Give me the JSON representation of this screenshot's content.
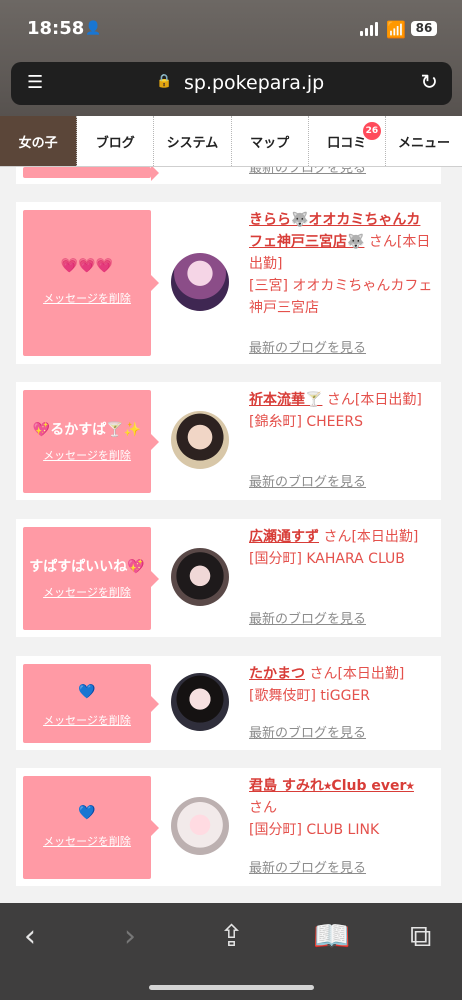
{
  "status": {
    "time": "18:58",
    "battery": "86"
  },
  "browser": {
    "url": "sp.pokepara.jp"
  },
  "tabs": [
    {
      "label": "女の子",
      "active": true
    },
    {
      "label": "ブログ"
    },
    {
      "label": "システム"
    },
    {
      "label": "マップ"
    },
    {
      "label": "口コミ",
      "badge": "26"
    },
    {
      "label": "メニュー"
    }
  ],
  "partial_blog_link": "最新のブログを見る",
  "cards": [
    {
      "message": "💗💗💗",
      "delete": "メッセージを削除",
      "name": "きらら🐺オオカミちゃんカフェ神戸三宮店🐺",
      "suffix": "さん[本日出勤]",
      "shop": "[三宮] オオカミちゃんカフェ神戸三宮店",
      "blog": "最新のブログを見る"
    },
    {
      "message": "💖るかすぱ🍸✨",
      "delete": "メッセージを削除",
      "name": "祈本流華🍸",
      "suffix": "さん[本日出勤]",
      "shop": "[錦糸町] CHEERS",
      "blog": "最新のブログを見る"
    },
    {
      "message": "すぱすぱいいね💖",
      "delete": "メッセージを削除",
      "name": "広瀬通すず",
      "suffix": "さん[本日出勤]",
      "shop": "[国分町] KAHARA CLUB",
      "blog": "最新のブログを見る"
    },
    {
      "message": "💙",
      "delete": "メッセージを削除",
      "name": "たかまつ",
      "suffix": "さん[本日出勤]",
      "shop": "[歌舞伎町] tiGGER",
      "blog": "最新のブログを見る"
    },
    {
      "message": "💙",
      "delete": "メッセージを削除",
      "name": "君島 すみれ⭑Club ever⭑",
      "suffix": "さん",
      "shop": "[国分町] CLUB LINK",
      "blog": "最新のブログを見る"
    }
  ]
}
